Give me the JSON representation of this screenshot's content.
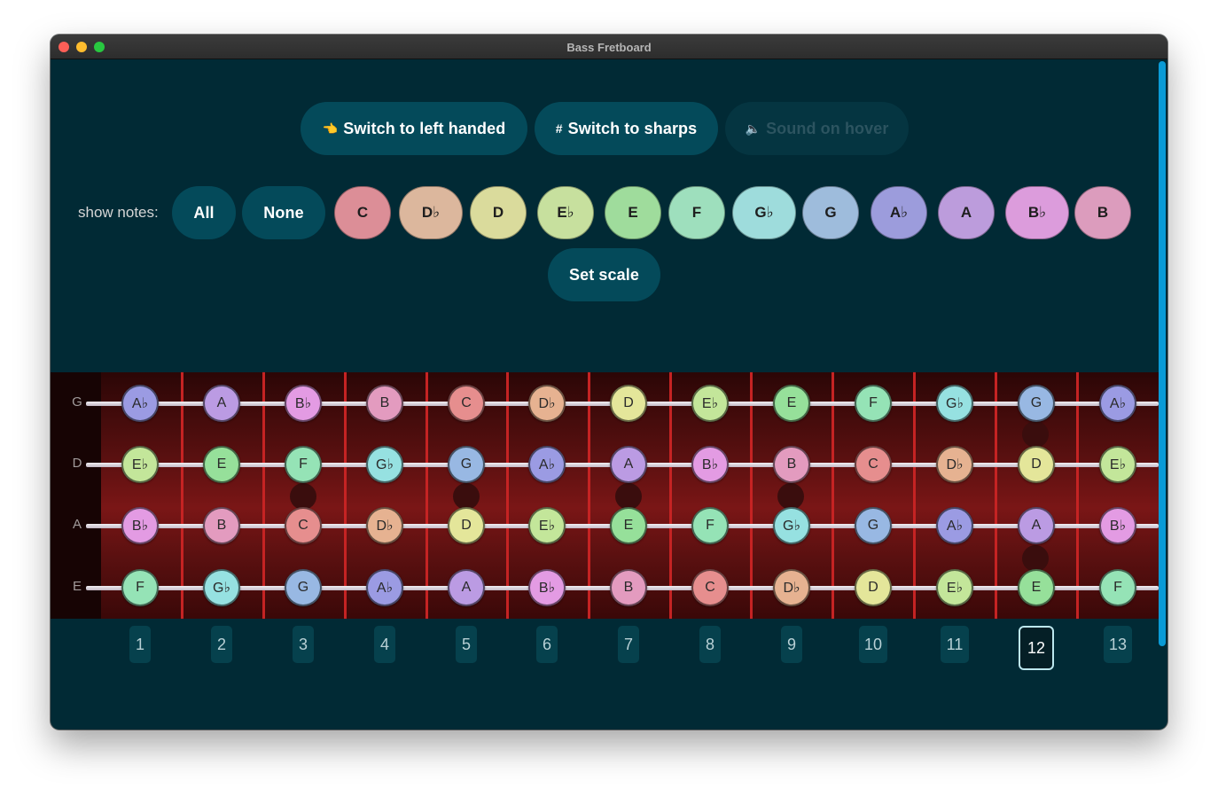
{
  "window": {
    "title": "Bass Fretboard"
  },
  "toolbar": {
    "left_handed": {
      "icon": "👈",
      "label": "Switch to left handed"
    },
    "sharps": {
      "icon": "#",
      "label": "Switch to sharps"
    },
    "sound": {
      "icon": "🔈",
      "label": "Sound on hover",
      "disabled": true
    }
  },
  "show_notes": {
    "label": "show notes:",
    "all_label": "All",
    "none_label": "None",
    "set_scale_label": "Set scale",
    "notes": [
      {
        "label": "C",
        "color": "#dc8e97"
      },
      {
        "label": "D♭",
        "color": "#dcb79d"
      },
      {
        "label": "D",
        "color": "#dadb9c"
      },
      {
        "label": "E♭",
        "color": "#c7e09e"
      },
      {
        "label": "E",
        "color": "#9fdc9c"
      },
      {
        "label": "F",
        "color": "#9edfbd"
      },
      {
        "label": "G♭",
        "color": "#9edcdc"
      },
      {
        "label": "G",
        "color": "#9ebcdc"
      },
      {
        "label": "A♭",
        "color": "#9c9cdc"
      },
      {
        "label": "A",
        "color": "#bc9cdc"
      },
      {
        "label": "B♭",
        "color": "#dc9cdc"
      },
      {
        "label": "B",
        "color": "#dc9cbd"
      }
    ]
  },
  "fretboard": {
    "strings": [
      {
        "name": "G",
        "notes": [
          "A♭",
          "A",
          "B♭",
          "B",
          "C",
          "D♭",
          "D",
          "E♭",
          "E",
          "F",
          "G♭",
          "G",
          "A♭"
        ]
      },
      {
        "name": "D",
        "notes": [
          "E♭",
          "E",
          "F",
          "G♭",
          "G",
          "A♭",
          "A",
          "B♭",
          "B",
          "C",
          "D♭",
          "D",
          "E♭"
        ]
      },
      {
        "name": "A",
        "notes": [
          "B♭",
          "B",
          "C",
          "D♭",
          "D",
          "E♭",
          "E",
          "F",
          "G♭",
          "G",
          "A♭",
          "A",
          "B♭"
        ]
      },
      {
        "name": "E",
        "notes": [
          "F",
          "G♭",
          "G",
          "A♭",
          "A",
          "B♭",
          "B",
          "C",
          "D♭",
          "D",
          "E♭",
          "E",
          "F"
        ]
      }
    ],
    "fret_numbers": [
      "1",
      "2",
      "3",
      "4",
      "5",
      "6",
      "7",
      "8",
      "9",
      "10",
      "11",
      "12",
      "13"
    ],
    "selected_fret": "12"
  }
}
